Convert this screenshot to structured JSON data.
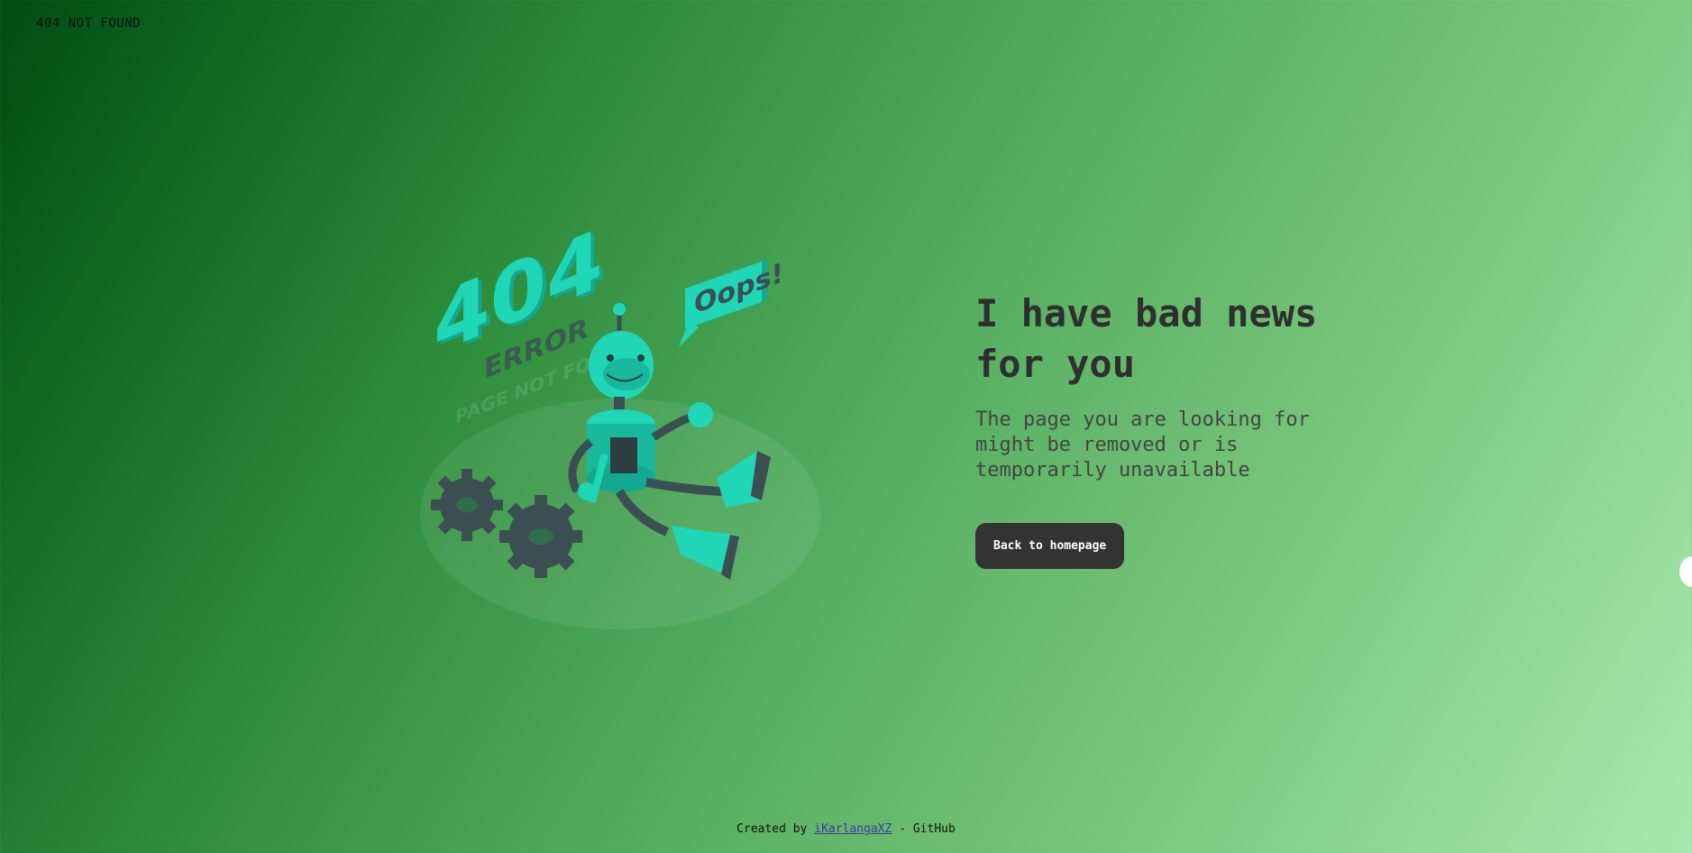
{
  "header": {
    "title": "404 NOT FOUND"
  },
  "illustration": {
    "big_text": "404",
    "error_text": "ERROR",
    "page_not_found_text": "PAGE NOT FOUND",
    "bubble_text": "Oops!",
    "colors": {
      "teal": "#1fd6b6",
      "teal_dark": "#13a891",
      "slate": "#3b4f52"
    }
  },
  "main": {
    "headline": "I have bad news for you",
    "subtext": "The page you are looking for might be removed or is temporarily unavailable",
    "button_label": "Back to homepage"
  },
  "footer": {
    "prefix": "Created by",
    "author_link": "iKarlangaXZ",
    "suffix": "- GitHub"
  }
}
